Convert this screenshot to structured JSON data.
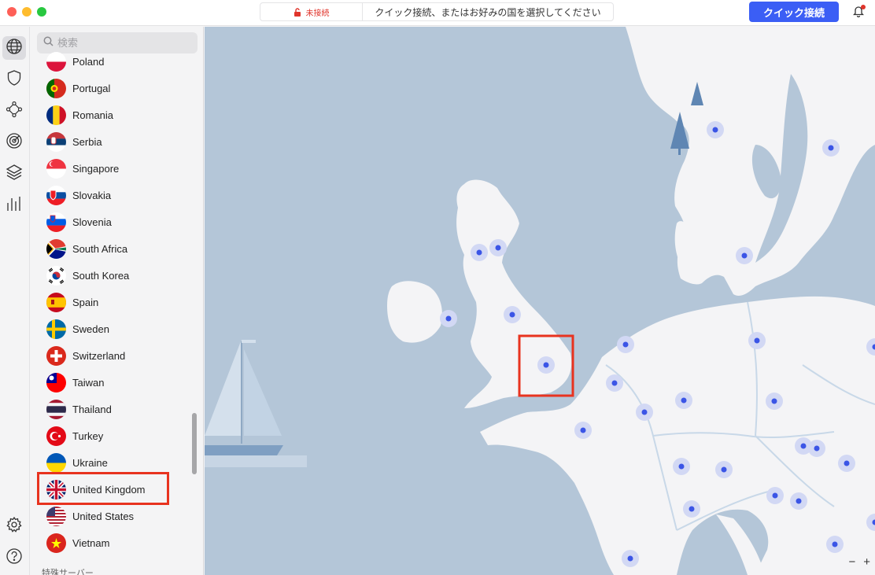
{
  "titlebar": {
    "status": "未接続",
    "message": "クイック接続、またはお好みの国を選択してください",
    "quick_connect": "クイック接続"
  },
  "search": {
    "placeholder": "検索"
  },
  "countries": [
    {
      "name": "Poland",
      "flag": "poland-flag"
    },
    {
      "name": "Portugal",
      "flag": "portugal-flag"
    },
    {
      "name": "Romania",
      "flag": "romania-flag"
    },
    {
      "name": "Serbia",
      "flag": "serbia-flag"
    },
    {
      "name": "Singapore",
      "flag": "singapore-flag"
    },
    {
      "name": "Slovakia",
      "flag": "slovakia-flag"
    },
    {
      "name": "Slovenia",
      "flag": "slovenia-flag"
    },
    {
      "name": "South Africa",
      "flag": "south-africa-flag"
    },
    {
      "name": "South Korea",
      "flag": "south-korea-flag"
    },
    {
      "name": "Spain",
      "flag": "spain-flag"
    },
    {
      "name": "Sweden",
      "flag": "sweden-flag"
    },
    {
      "name": "Switzerland",
      "flag": "switzerland-flag"
    },
    {
      "name": "Taiwan",
      "flag": "taiwan-flag"
    },
    {
      "name": "Thailand",
      "flag": "thailand-flag"
    },
    {
      "name": "Turkey",
      "flag": "turkey-flag"
    },
    {
      "name": "Ukraine",
      "flag": "ukraine-flag"
    },
    {
      "name": "United Kingdom",
      "flag": "uk-flag"
    },
    {
      "name": "United States",
      "flag": "us-flag"
    },
    {
      "name": "Vietnam",
      "flag": "vietnam-flag"
    }
  ],
  "section_label": "特殊サーバー",
  "map": {
    "zoom_out": "−",
    "zoom_in": "+"
  },
  "colors": {
    "accent": "#3b5ef5",
    "water": "#b4c6d8",
    "land": "#f4f4f6",
    "highlight": "#e8331f",
    "server_dot": "#3b55e6"
  }
}
